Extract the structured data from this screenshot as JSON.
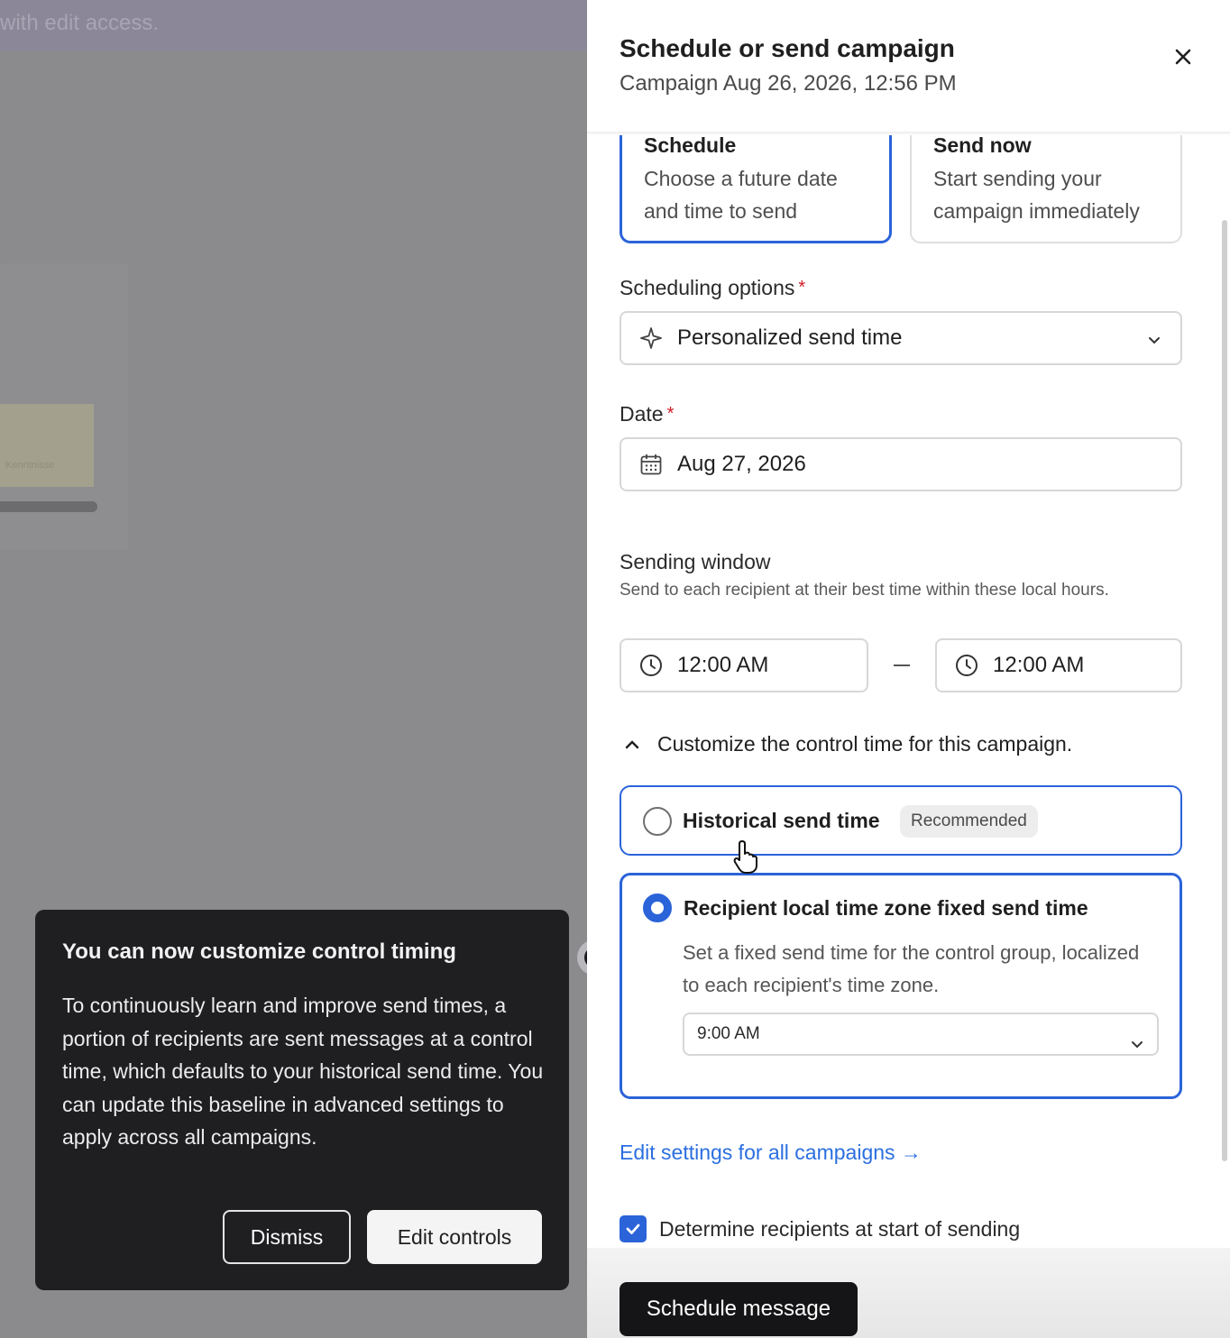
{
  "backdrop": {
    "banner_text": "with edit access.",
    "thumb_text": "Kenntnisse"
  },
  "drawer": {
    "title": "Schedule or send campaign",
    "subtitle": "Campaign Aug 26, 2026, 12:56 PM",
    "close_icon": "close-icon"
  },
  "send_modes": [
    {
      "title": "Schedule",
      "description_line1": "Choose a future date",
      "description_line2": "and time to send",
      "selected": true
    },
    {
      "title": "Send now",
      "description_line1": "Start sending your",
      "description_line2": "campaign immediately",
      "selected": false
    }
  ],
  "scheduling": {
    "label": "Scheduling options",
    "required_mark": "*",
    "value": "Personalized send time",
    "icon": "sparkle-icon"
  },
  "date": {
    "label": "Date",
    "required_mark": "*",
    "value": "Aug 27, 2026",
    "icon": "calendar-icon"
  },
  "sending_window": {
    "label": "Sending window",
    "help": "Send to each recipient at their best time within these local hours.",
    "start": "12:00 AM",
    "end": "12:00 AM",
    "separator": "–"
  },
  "control_time": {
    "toggle_label": "Customize the control time for this campaign.",
    "options": [
      {
        "label": "Historical send time",
        "badge": "Recommended",
        "selected": false
      },
      {
        "label": "Recipient local time zone fixed send time",
        "description": "Set a fixed send time for the control group, localized to each recipient's time zone.",
        "time_value": "9:00 AM",
        "selected": true
      }
    ]
  },
  "edit_link": "Edit settings for all campaigns →",
  "determine_recipients": {
    "label": "Determine recipients at start of sending",
    "checked": true
  },
  "primary_action": "Schedule message",
  "tour": {
    "title": "You can now customize control timing",
    "body": "To continuously learn and improve send times, a portion of recipients are sent messages at a control time, which defaults to your historical send time. You can update this baseline in advanced settings to apply across all campaigns.",
    "dismiss": "Dismiss",
    "edit_controls": "Edit controls"
  },
  "colors": {
    "accent": "#2b63d9",
    "link": "#2b6fe0",
    "required": "#d11b26",
    "tooltip_bg": "#1f1f22",
    "primary_button": "#151517"
  }
}
